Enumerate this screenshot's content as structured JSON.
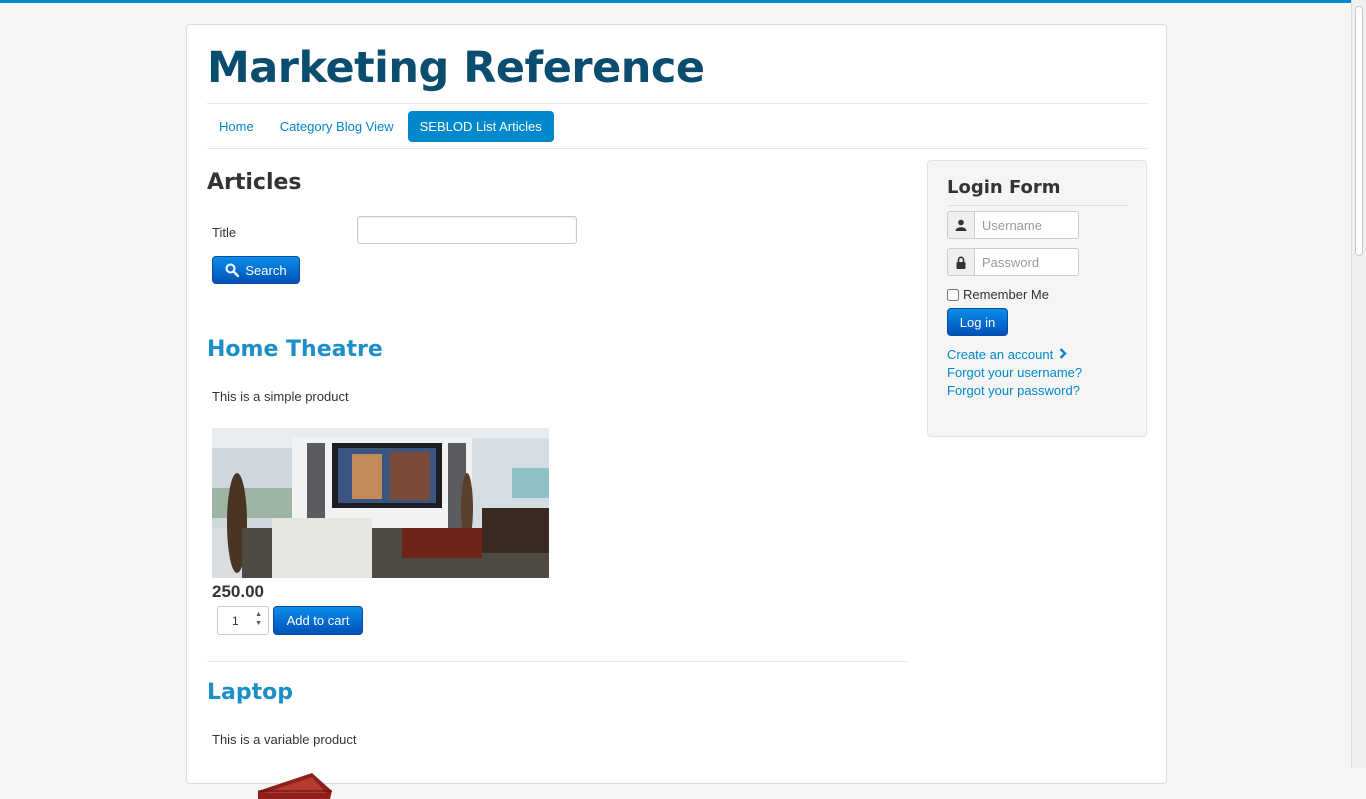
{
  "site": {
    "title": "Marketing Reference"
  },
  "nav": {
    "items": [
      {
        "label": "Home"
      },
      {
        "label": "Category Blog View"
      },
      {
        "label": "SEBLOD List Articles"
      }
    ]
  },
  "main": {
    "heading": "Articles",
    "filter": {
      "title_label": "Title",
      "title_value": "",
      "search_label": "Search"
    },
    "articles": [
      {
        "title": "Home Theatre",
        "description": "This is a simple product",
        "image_icon": "home-theatre-image",
        "price": "250.00",
        "quantity": "1",
        "add_to_cart_label": "Add to cart"
      },
      {
        "title": "Laptop",
        "description": "This is a variable product",
        "image_icon": "laptop-image"
      }
    ]
  },
  "login": {
    "heading": "Login Form",
    "username_placeholder": "Username",
    "password_placeholder": "Password",
    "remember_label": "Remember Me",
    "login_label": "Log in",
    "create_account": "Create an account",
    "forgot_username": "Forgot your username?",
    "forgot_password": "Forgot your password?"
  },
  "colors": {
    "accent": "#0088cc",
    "title": "#0b4d6f",
    "button": "#0066cc"
  }
}
